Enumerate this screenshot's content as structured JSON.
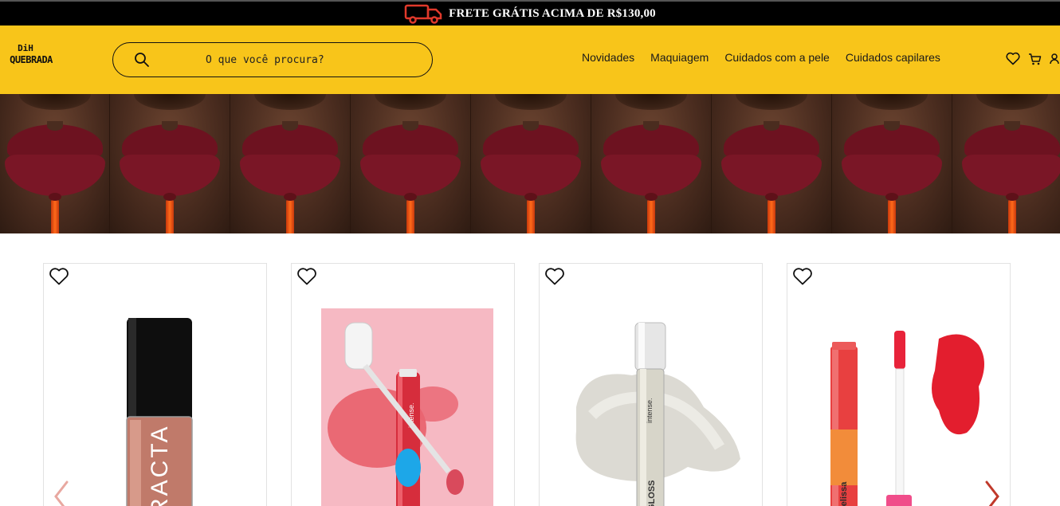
{
  "announcement": {
    "text": "FRETE GRÁTIS ACIMA DE R$130,00",
    "icon": "truck-icon",
    "icon_color": "#e0392b"
  },
  "header": {
    "background": "#f8c51a",
    "logo": {
      "line1": "DiH",
      "line2": "QUEBRADA"
    },
    "search": {
      "placeholder": "O que você procura?"
    },
    "nav": [
      "Novidades",
      "Maquiagem",
      "Cuidados com a pele",
      "Cuidados capilares"
    ],
    "icons": [
      "heart-icon",
      "cart-icon",
      "user-icon"
    ]
  },
  "banner": {
    "alt_theme": "lips with red lipstick repeated",
    "tile_count": 9
  },
  "products": [
    {
      "id": "product-1",
      "image_text": "RACTA",
      "favorite_icon": "heart-outline-icon"
    },
    {
      "id": "product-2",
      "image_text": "intense.",
      "favorite_icon": "heart-outline-icon"
    },
    {
      "id": "product-3",
      "image_text": "GLOSS",
      "favorite_icon": "heart-outline-icon"
    },
    {
      "id": "product-4",
      "image_text": "melissa",
      "favorite_icon": "heart-outline-icon"
    }
  ],
  "carousel": {
    "prev_icon": "chevron-left-icon",
    "next_icon": "chevron-right-icon",
    "accent": "#c0392b"
  }
}
